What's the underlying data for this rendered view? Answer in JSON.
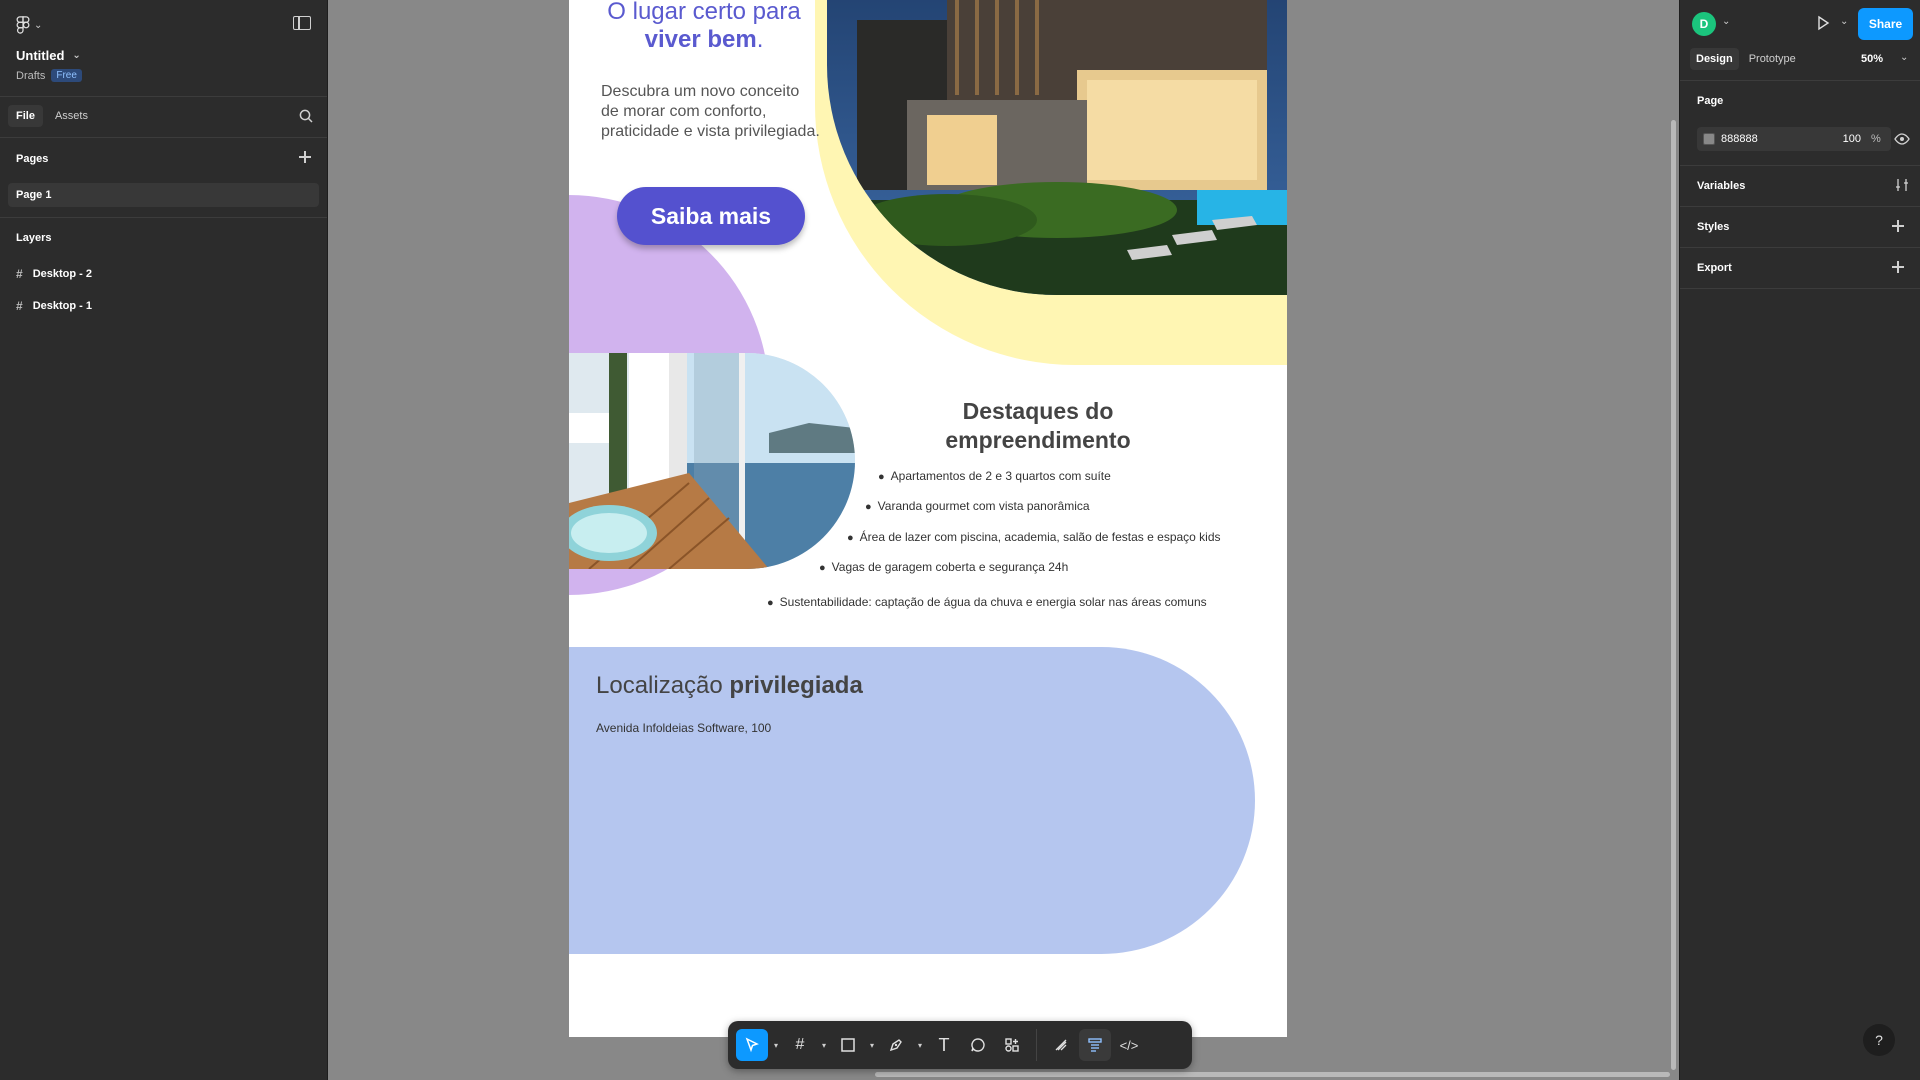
{
  "app": {
    "file_title": "Untitled",
    "drafts_label": "Drafts",
    "plan_badge": "Free"
  },
  "left_panel": {
    "tabs": [
      "File",
      "Assets"
    ],
    "pages_header": "Pages",
    "pages": [
      "Page 1"
    ],
    "layers_header": "Layers",
    "layers": [
      "Desktop - 2",
      "Desktop - 1"
    ]
  },
  "canvas": {
    "hero_title_line1": "O lugar certo para",
    "hero_title_bold": "viver bem",
    "hero_title_end": ".",
    "hero_description": "Descubra um novo conceito de morar com conforto, praticidade e vista privilegiada.",
    "cta_label": "Saiba mais",
    "highlights_title": "Destaques do empreendimento",
    "features": [
      "Apartamentos de 2 e 3 quartos com suíte",
      "Varanda gourmet com vista panorâmica",
      "Área de lazer com piscina, academia, salão de festas e espaço kids",
      "Vagas de garagem coberta e segurança 24h",
      "Sustentabilidade: captação de água da chuva e energia solar nas áreas comuns"
    ],
    "location_title_regular": "Localização",
    "location_title_bold": "privilegiada",
    "location_address": "Avenida Infoldeias Software, 100"
  },
  "right_panel": {
    "avatar_initial": "D",
    "share_label": "Share",
    "tabs": [
      "Design",
      "Prototype"
    ],
    "zoom": "50%",
    "page_section": "Page",
    "page_color_hex": "888888",
    "page_opacity": "100",
    "opacity_unit": "%",
    "variables_label": "Variables",
    "styles_label": "Styles",
    "export_label": "Export",
    "help_label": "?"
  },
  "colors": {
    "accent": "#0d99ff",
    "cta": "#5451cf",
    "yellow": "#fff6b3",
    "purple": "#d1b3ee",
    "location": "#b5c6ef",
    "canvas_bg": "#888888"
  }
}
